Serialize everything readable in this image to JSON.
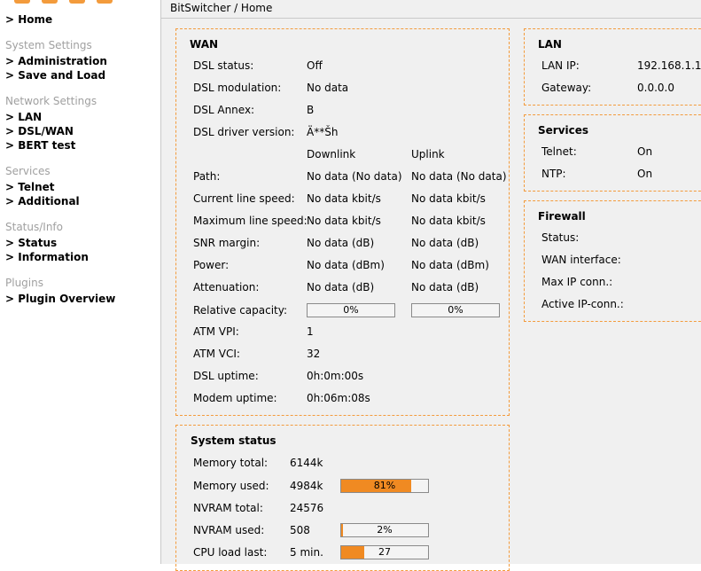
{
  "sidebar": {
    "home": "> Home",
    "sections": [
      {
        "title": "System Settings",
        "items": [
          "> Administration",
          "> Save and Load"
        ]
      },
      {
        "title": "Network Settings",
        "items": [
          "> LAN",
          "> DSL/WAN",
          "> BERT test"
        ]
      },
      {
        "title": "Services",
        "items": [
          "> Telnet",
          "> Additional"
        ]
      },
      {
        "title": "Status/Info",
        "items": [
          "> Status",
          "> Information"
        ]
      },
      {
        "title": "Plugins",
        "items": [
          "> Plugin Overview"
        ]
      }
    ]
  },
  "breadcrumb": "BitSwitcher / Home",
  "wan": {
    "title": "WAN",
    "dsl_status": {
      "label": "DSL status:",
      "value": "Off"
    },
    "dsl_modulation": {
      "label": "DSL modulation:",
      "value": "No data"
    },
    "dsl_annex": {
      "label": "DSL Annex:",
      "value": "B"
    },
    "dsl_driver": {
      "label": "DSL driver version:",
      "value": "Ä**Šh"
    },
    "col_downlink": "Downlink",
    "col_uplink": "Uplink",
    "rows": [
      {
        "label": "Path:",
        "down": "No data (No data)",
        "up": "No data (No data)"
      },
      {
        "label": "Current line speed:",
        "down": "No data kbit/s",
        "up": "No data kbit/s"
      },
      {
        "label": "Maximum line speed:",
        "down": "No data kbit/s",
        "up": "No data kbit/s"
      },
      {
        "label": "SNR margin:",
        "down": "No data (dB)",
        "up": "No data (dB)"
      },
      {
        "label": "Power:",
        "down": "No data (dBm)",
        "up": "No data (dBm)"
      },
      {
        "label": "Attenuation:",
        "down": "No data (dB)",
        "up": "No data (dB)"
      }
    ],
    "relative_capacity": {
      "label": "Relative capacity:",
      "down": "0%",
      "up": "0%",
      "down_fraction": 0,
      "up_fraction": 0
    },
    "atm_vpi": {
      "label": "ATM VPI:",
      "value": "1"
    },
    "atm_vci": {
      "label": "ATM VCI:",
      "value": "32"
    },
    "dsl_uptime": {
      "label": "DSL uptime:",
      "value": "0h:0m:00s"
    },
    "modem_uptime": {
      "label": "Modem uptime:",
      "value": "0h:06m:08s"
    }
  },
  "system_status": {
    "title": "System status",
    "memory_total": {
      "label": "Memory total:",
      "value": "6144k"
    },
    "memory_used": {
      "label": "Memory used:",
      "value": "4984k",
      "bar_text": "81%",
      "fraction": 0.81
    },
    "nvram_total": {
      "label": "NVRAM total:",
      "value": "24576"
    },
    "nvram_used": {
      "label": "NVRAM used:",
      "value": "508",
      "bar_text": "2%",
      "fraction": 0.02
    },
    "cpu_load": {
      "label": "CPU load last:",
      "value": "5 min.",
      "bar_text": "27",
      "fraction": 0.27
    }
  },
  "lan": {
    "title": "LAN",
    "ip": {
      "label": "LAN IP:",
      "value": "192.168.1.1"
    },
    "gateway": {
      "label": "Gateway:",
      "value": "0.0.0.0"
    }
  },
  "services": {
    "title": "Services",
    "telnet": {
      "label": "Telnet:",
      "value": "On"
    },
    "ntp": {
      "label": "NTP:",
      "value": "On"
    }
  },
  "firewall": {
    "title": "Firewall",
    "status": {
      "label": "Status:"
    },
    "wan_interface": {
      "label": "WAN interface:"
    },
    "max_ip_conn": {
      "label": "Max IP conn.:"
    },
    "active_ip_conn": {
      "label": "Active IP-conn.:"
    }
  },
  "colors": {
    "accent": "#f08a22",
    "panel_border": "#f39b3c",
    "section_title": "#a0a0a0",
    "main_bg": "#f0f0f0"
  }
}
